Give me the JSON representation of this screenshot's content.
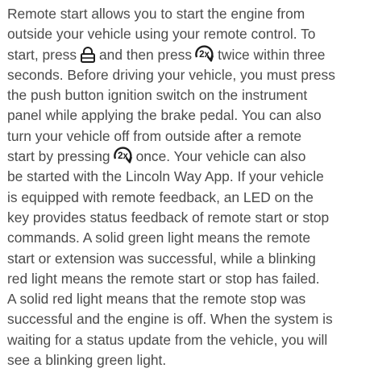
{
  "document": {
    "paragraph": {
      "lines": [
        {
          "text": "Remote start allows you to start the engine from"
        },
        {
          "text": "outside your vehicle using your remote control. To"
        },
        {
          "segments": [
            "start, press",
            "and then press",
            "twice within three"
          ],
          "icons": [
            "lock-icon",
            "remote-start-2x-icon"
          ]
        },
        {
          "text": "seconds. Before driving your vehicle, you must press"
        },
        {
          "text": "the push button ignition switch on the instrument"
        },
        {
          "text": "panel while applying the brake pedal. You can also"
        },
        {
          "text": "turn your vehicle off from outside after a remote"
        },
        {
          "segments": [
            "start by pressing",
            "once. Your vehicle can also"
          ],
          "icons": [
            "remote-start-2x-icon"
          ]
        },
        {
          "text": "be started with the Lincoln Way App. If your vehicle"
        },
        {
          "text": "is equipped with remote feedback, an LED on the"
        },
        {
          "text": "key provides status feedback of remote start or stop"
        },
        {
          "text": "commands. A solid green light means the remote"
        },
        {
          "text": "start or extension was successful, while a blinking"
        },
        {
          "text": "red light means the remote start or stop has failed."
        },
        {
          "text": "A solid red light means that the remote stop was"
        },
        {
          "text": "successful and the engine is off. When the system is"
        },
        {
          "text": "waiting for a status update from the vehicle, you will"
        },
        {
          "text": "see a blinking green light."
        }
      ],
      "icon_glyph_2x": "2x"
    },
    "colors": {
      "text": "#4a4a4a",
      "background": "#ffffff"
    }
  }
}
